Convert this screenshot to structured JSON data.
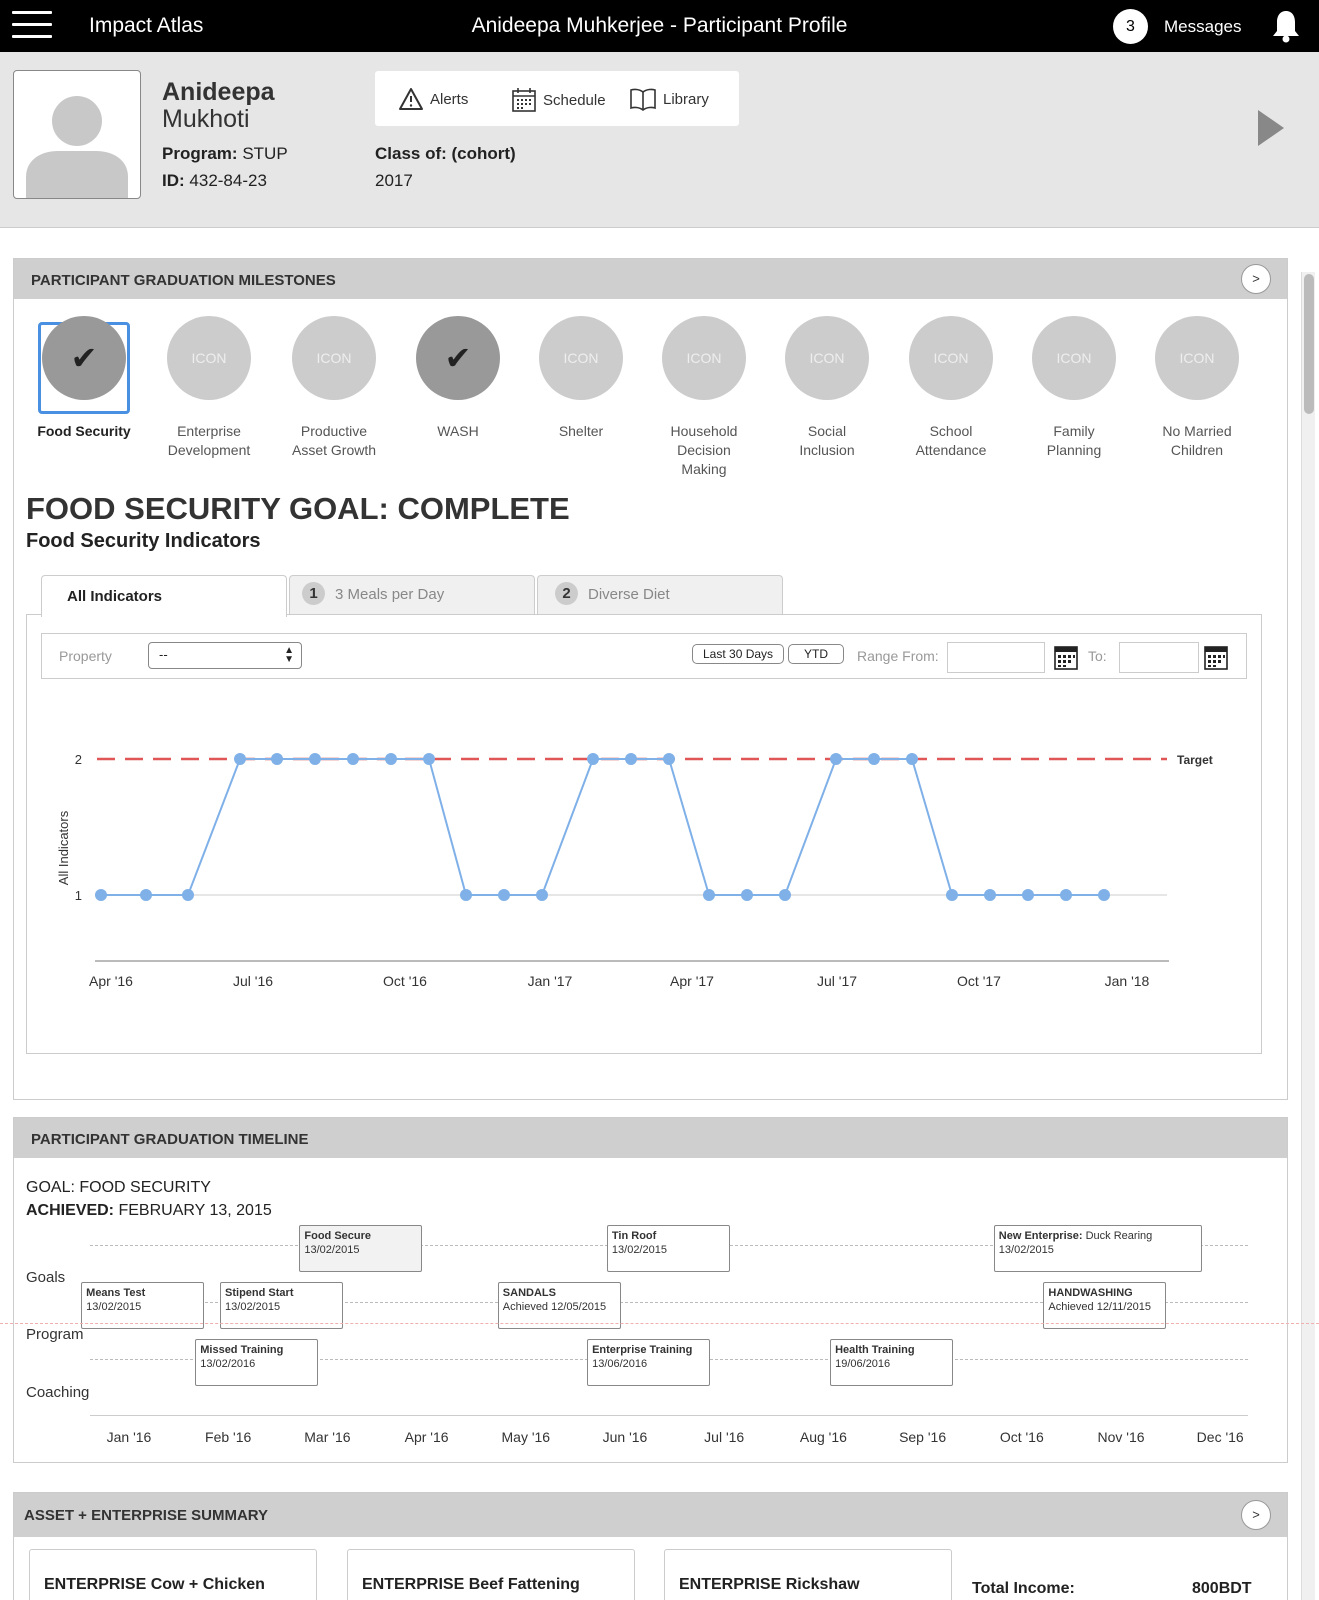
{
  "topbar": {
    "app_title": "Impact Atlas",
    "page_title": "Anideepa Muhkerjee - Participant Profile",
    "message_count": "3",
    "messages_label": "Messages"
  },
  "profile": {
    "first_name": "Anideepa",
    "last_name": "Mukhoti",
    "program_label": "Program:",
    "program_value": "STUP",
    "id_label": "ID:",
    "id_value": "432-84-23",
    "class_label": "Class of: (cohort)",
    "class_value": "2017",
    "quick_links": {
      "alerts": "Alerts",
      "schedule": "Schedule",
      "library": "Library"
    }
  },
  "milestones": {
    "title": "PARTICIPANT GRADUATION MILESTONES",
    "expand": ">",
    "items": [
      {
        "label": "Food Security",
        "done": true,
        "selected": true
      },
      {
        "label": "Enterprise Development",
        "done": false,
        "icon_text": "ICON"
      },
      {
        "label": "Productive Asset Growth",
        "done": false,
        "icon_text": "ICON"
      },
      {
        "label": "WASH",
        "done": true
      },
      {
        "label": "Shelter",
        "done": false,
        "icon_text": "ICON"
      },
      {
        "label": "Household Decision Making",
        "done": false,
        "icon_text": "ICON"
      },
      {
        "label": "Social Inclusion",
        "done": false,
        "icon_text": "ICON"
      },
      {
        "label": "School Attendance",
        "done": false,
        "icon_text": "ICON"
      },
      {
        "label": "Family Planning",
        "done": false,
        "icon_text": "ICON"
      },
      {
        "label": "No Married Children",
        "done": false,
        "icon_text": "ICON"
      }
    ],
    "check_glyph": "✔",
    "goal_heading": "FOOD SECURITY GOAL: COMPLETE",
    "indicators_heading": "Food Security Indicators",
    "tabs": [
      {
        "label": "All Indicators",
        "num": ""
      },
      {
        "label": "3 Meals per Day",
        "num": "1"
      },
      {
        "label": "Diverse Diet",
        "num": "2"
      }
    ],
    "filters": {
      "property_label": "Property",
      "property_value": "--",
      "last30": "Last 30 Days",
      "ytd": "YTD",
      "range_from": "Range From:",
      "to": "To:"
    }
  },
  "chart_data": {
    "type": "line",
    "ylabel": "All Indicators",
    "yticks": [
      1,
      2
    ],
    "ylim": [
      0.5,
      2.5
    ],
    "target_value": 2,
    "target_label": "Target",
    "xticks": [
      "Apr '16",
      "Jul '16",
      "Oct '16",
      "Jan '17",
      "Apr '17",
      "Jul '17",
      "Oct '17",
      "Jan '18"
    ],
    "series": [
      {
        "values": [
          1,
          1,
          1,
          2,
          2,
          2,
          2,
          2,
          2,
          1,
          1,
          1,
          2,
          2,
          2,
          1,
          1,
          1,
          2,
          2,
          2,
          1,
          1,
          1,
          1,
          1
        ]
      }
    ],
    "color": "#7fb0e8",
    "target_color": "#e05555"
  },
  "timeline": {
    "title": "PARTICIPANT GRADUATION TIMELINE",
    "goal_label": "GOAL: FOOD SECURITY",
    "achieved_label": "ACHIEVED:",
    "achieved_value": "FEBRUARY 13, 2015",
    "rows": [
      "Goals",
      "Program",
      "Coaching"
    ],
    "months": [
      "Jan '16",
      "Feb '16",
      "Mar '16",
      "Apr '16",
      "May '16",
      "Jun '16",
      "Jul '16",
      "Aug '16",
      "Sep '16",
      "Oct '16",
      "Nov '16",
      "Dec '16"
    ],
    "events": [
      {
        "row": 0,
        "month": 2.0,
        "title": "Food Secure",
        "sub": "",
        "date": "13/02/2015",
        "shaded": true
      },
      {
        "row": 0,
        "month": 5.1,
        "title": "Tin Roof",
        "sub": "",
        "date": "13/02/2015"
      },
      {
        "row": 0,
        "month": 9.0,
        "title": "New Enterprise:",
        "sub": " Duck Rearing",
        "date": "13/02/2015",
        "wide": true
      },
      {
        "row": 1,
        "month": -0.2,
        "title": "Means Test",
        "sub": "",
        "date": "13/02/2015"
      },
      {
        "row": 1,
        "month": 1.2,
        "title": "Stipend Start",
        "sub": "",
        "date": "13/02/2015"
      },
      {
        "row": 1,
        "month": 4.0,
        "title": "SANDALS",
        "sub": "",
        "date": "Achieved 12/05/2015"
      },
      {
        "row": 1,
        "month": 9.5,
        "title": "HANDWASHING",
        "sub": "",
        "date": "Achieved 12/11/2015"
      },
      {
        "row": 2,
        "month": 0.95,
        "title": "Missed Training",
        "sub": "",
        "date": "13/02/2016"
      },
      {
        "row": 2,
        "month": 4.9,
        "title": "Enterprise Training",
        "sub": "",
        "date": "13/06/2016"
      },
      {
        "row": 2,
        "month": 7.35,
        "title": "Health Training",
        "sub": "",
        "date": "19/06/2016"
      }
    ]
  },
  "assets": {
    "title": "ASSET + ENTERPRISE SUMMARY",
    "expand": ">",
    "enterprises": [
      {
        "prefix": "ENTERPRISE",
        "name": "Cow + Chicken"
      },
      {
        "prefix": "ENTERPRISE",
        "name": "Beef Fattening"
      },
      {
        "prefix": "ENTERPRISE",
        "name": "Rickshaw"
      }
    ],
    "total_income_label": "Total Income:",
    "total_income_value": "800BDT"
  }
}
